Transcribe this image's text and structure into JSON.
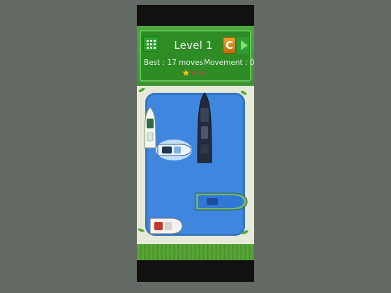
{
  "header": {
    "title": "Level 1",
    "best": "Best : 17 moves",
    "movement": "Movement : 0",
    "restart_label": "C",
    "stars_earned": 1,
    "stars_total": 3
  },
  "colors": {
    "frame": "#626a63",
    "header_green": "#3d9330",
    "water": "#3f86de",
    "restart_orange": "#e08a1e",
    "star_gold": "#f4c21a"
  },
  "icons": [
    "menu-grid-icon",
    "restart-icon",
    "next-arrow-icon",
    "star-icon"
  ]
}
